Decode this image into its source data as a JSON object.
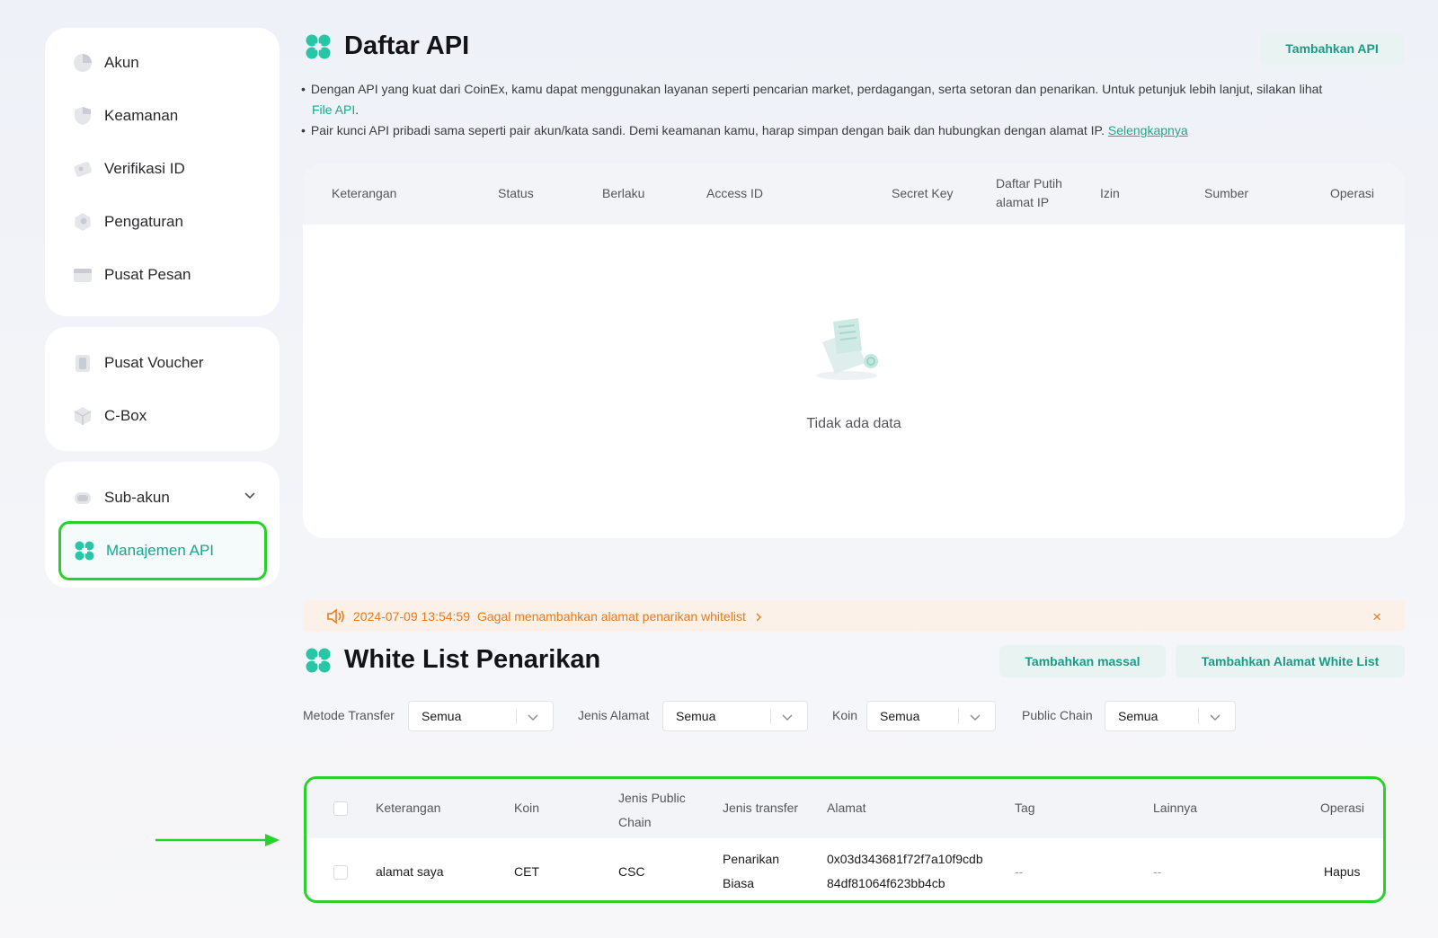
{
  "sidebar": {
    "group1": [
      {
        "label": "Akun",
        "icon": "pie-chart-icon"
      },
      {
        "label": "Keamanan",
        "icon": "shield-icon"
      },
      {
        "label": "Verifikasi ID",
        "icon": "id-card-icon"
      },
      {
        "label": "Pengaturan",
        "icon": "settings-icon"
      },
      {
        "label": "Pusat Pesan",
        "icon": "message-icon"
      }
    ],
    "group2": [
      {
        "label": "Pusat Voucher",
        "icon": "voucher-icon"
      },
      {
        "label": "C-Box",
        "icon": "box-icon"
      }
    ],
    "group3": [
      {
        "label": "Sub-akun",
        "icon": "sub-account-icon"
      },
      {
        "label": "Manajemen API",
        "icon": "api-icon"
      }
    ]
  },
  "api": {
    "title": "Daftar API",
    "add_button": "Tambahkan API",
    "bullet1": "Dengan API yang kuat dari CoinEx, kamu dapat menggunakan layanan seperti pencarian market, perdagangan, serta setoran dan penarikan. Untuk petunjuk lebih lanjut, silakan lihat",
    "bullet1_link": "File API",
    "bullet1_end": ".",
    "bullet2": "Pair kunci API pribadi sama seperti pair akun/kata sandi. Demi keamanan kamu, harap simpan dengan baik dan hubungkan dengan alamat IP.",
    "bullet2_link": "Selengkapnya",
    "columns": {
      "keterangan": "Keterangan",
      "status": "Status",
      "berlaku": "Berlaku",
      "access_id": "Access ID",
      "secret_key": "Secret Key",
      "whitelist_1": "Daftar Putih",
      "whitelist_2": "alamat IP",
      "izin": "Izin",
      "sumber": "Sumber",
      "operasi": "Operasi"
    },
    "empty_text": "Tidak ada data"
  },
  "notice": {
    "timestamp": "2024-07-09 13:54:59",
    "message": "Gagal menambahkan alamat penarikan whitelist",
    "close": "×"
  },
  "whitelist": {
    "title": "White List Penarikan",
    "bulk_button": "Tambahkan massal",
    "add_button": "Tambahkan Alamat White List",
    "filters": [
      {
        "label": "Metode Transfer",
        "value": "Semua"
      },
      {
        "label": "Jenis Alamat",
        "value": "Semua"
      },
      {
        "label": "Koin",
        "value": "Semua"
      },
      {
        "label": "Public Chain",
        "value": "Semua"
      }
    ],
    "columns": {
      "keterangan": "Keterangan",
      "koin": "Koin",
      "chain_1": "Jenis Public",
      "chain_2": "Chain",
      "jenis_transfer": "Jenis transfer",
      "alamat": "Alamat",
      "tag": "Tag",
      "lainnya": "Lainnya",
      "operasi": "Operasi"
    },
    "rows": [
      {
        "keterangan": "alamat saya",
        "koin": "CET",
        "chain": "CSC",
        "transfer_1": "Penarikan",
        "transfer_2": "Biasa",
        "alamat_1": "0x03d343681f72f7a10f9cdb",
        "alamat_2": "84df81064f623bb4cb",
        "tag": "--",
        "lainnya": "--",
        "operasi": "Hapus"
      }
    ]
  },
  "colors": {
    "accent": "#1aaa8c",
    "highlight": "#29d12b",
    "warning": "#ea7a1c"
  }
}
